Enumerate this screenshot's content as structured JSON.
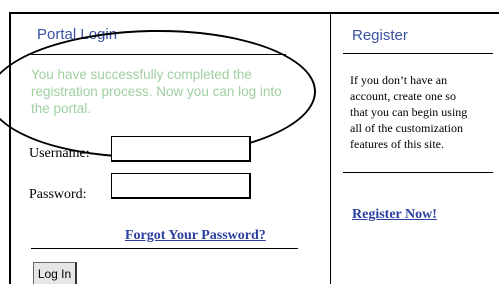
{
  "login": {
    "title": "Portal Login",
    "success_lines": [
      "You have successfully completed the",
      "registration process. Now you can log into",
      "the portal."
    ],
    "username_label": "Username:",
    "password_label": "Password:",
    "username_value": "",
    "password_value": "",
    "forgot_link": "Forgot Your Password?",
    "login_button": "Log In"
  },
  "register": {
    "title": "Register",
    "text_lines": [
      "If you don’t have an",
      "account, create one so",
      "that you can begin using",
      "all of the customization",
      "features of this site."
    ],
    "link": "Register Now!"
  },
  "colors": {
    "heading": "#3a52a0",
    "success_text": "#9fcf9f",
    "link": "#2b3fa0"
  }
}
